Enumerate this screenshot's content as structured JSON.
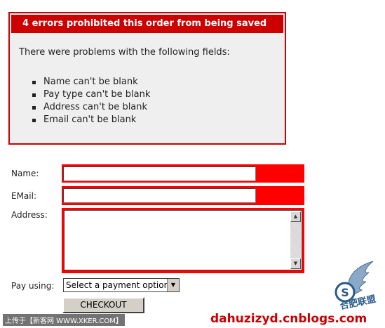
{
  "error_box": {
    "header": "4 errors prohibited this order from being saved",
    "intro": "There were problems with the following fields:",
    "errors": [
      "Name can't be blank",
      "Pay type can't be blank",
      "Address can't be blank",
      "Email can't be blank"
    ]
  },
  "form": {
    "name_label": "Name:",
    "email_label": "EMail:",
    "address_label": "Address:",
    "pay_label": "Pay using:",
    "pay_selected": "Select a payment option",
    "checkout_label": "CHECKOUT",
    "error_color": "#ff0000"
  },
  "watermarks": {
    "upload": "上传于【新客网 WWW.XKER.COM】",
    "site": "dahuzizyd.cnblogs.com",
    "logo_text": "合肥联盟"
  }
}
